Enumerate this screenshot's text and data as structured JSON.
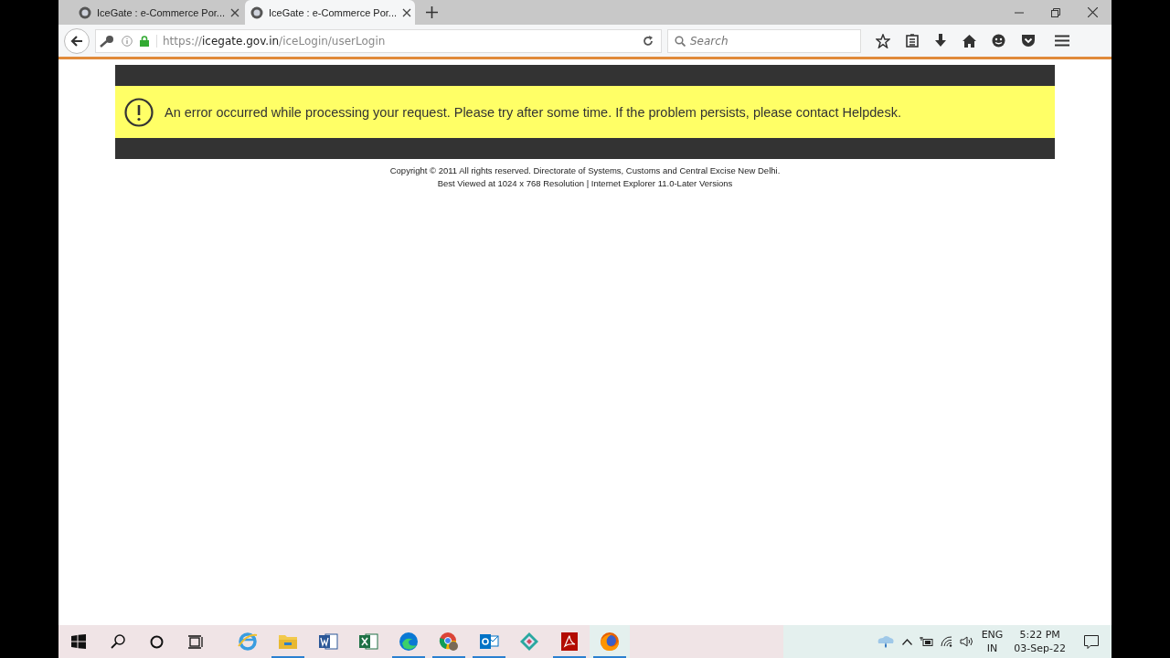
{
  "tabs": [
    {
      "title": "IceGate : e-Commerce Por...",
      "selected": false
    },
    {
      "title": "IceGate : e-Commerce Por...",
      "selected": true
    }
  ],
  "address_bar": {
    "scheme": "https://",
    "host": "icegate.gov.in",
    "path": "/iceLogin/userLogin"
  },
  "search": {
    "placeholder": "Search"
  },
  "alert": {
    "message": "An error occurred while processing your request. Please try after some time. If the problem persists, please contact Helpdesk."
  },
  "footer": [
    "Copyright © 2011 All rights reserved. Directorate of Systems, Customs and Central Excise New Delhi.",
    "Best Viewed at 1024 x 768 Resolution | Internet Explorer 11.0-Later Versions"
  ],
  "taskbar": {
    "apps": [
      {
        "kind": "ie",
        "running": false,
        "active": false
      },
      {
        "kind": "folder",
        "running": true,
        "active": false
      },
      {
        "kind": "word",
        "running": false,
        "active": false
      },
      {
        "kind": "excel",
        "running": false,
        "active": false
      },
      {
        "kind": "edge",
        "running": true,
        "active": false
      },
      {
        "kind": "chrome",
        "running": true,
        "active": false
      },
      {
        "kind": "outlook",
        "running": true,
        "active": false
      },
      {
        "kind": "grid",
        "running": false,
        "active": false
      },
      {
        "kind": "acrobat",
        "running": true,
        "active": false
      },
      {
        "kind": "firefox",
        "running": true,
        "active": true
      }
    ],
    "language": "ENG",
    "region": "IN",
    "time": "5:22 PM",
    "date": "03-Sep-22"
  }
}
